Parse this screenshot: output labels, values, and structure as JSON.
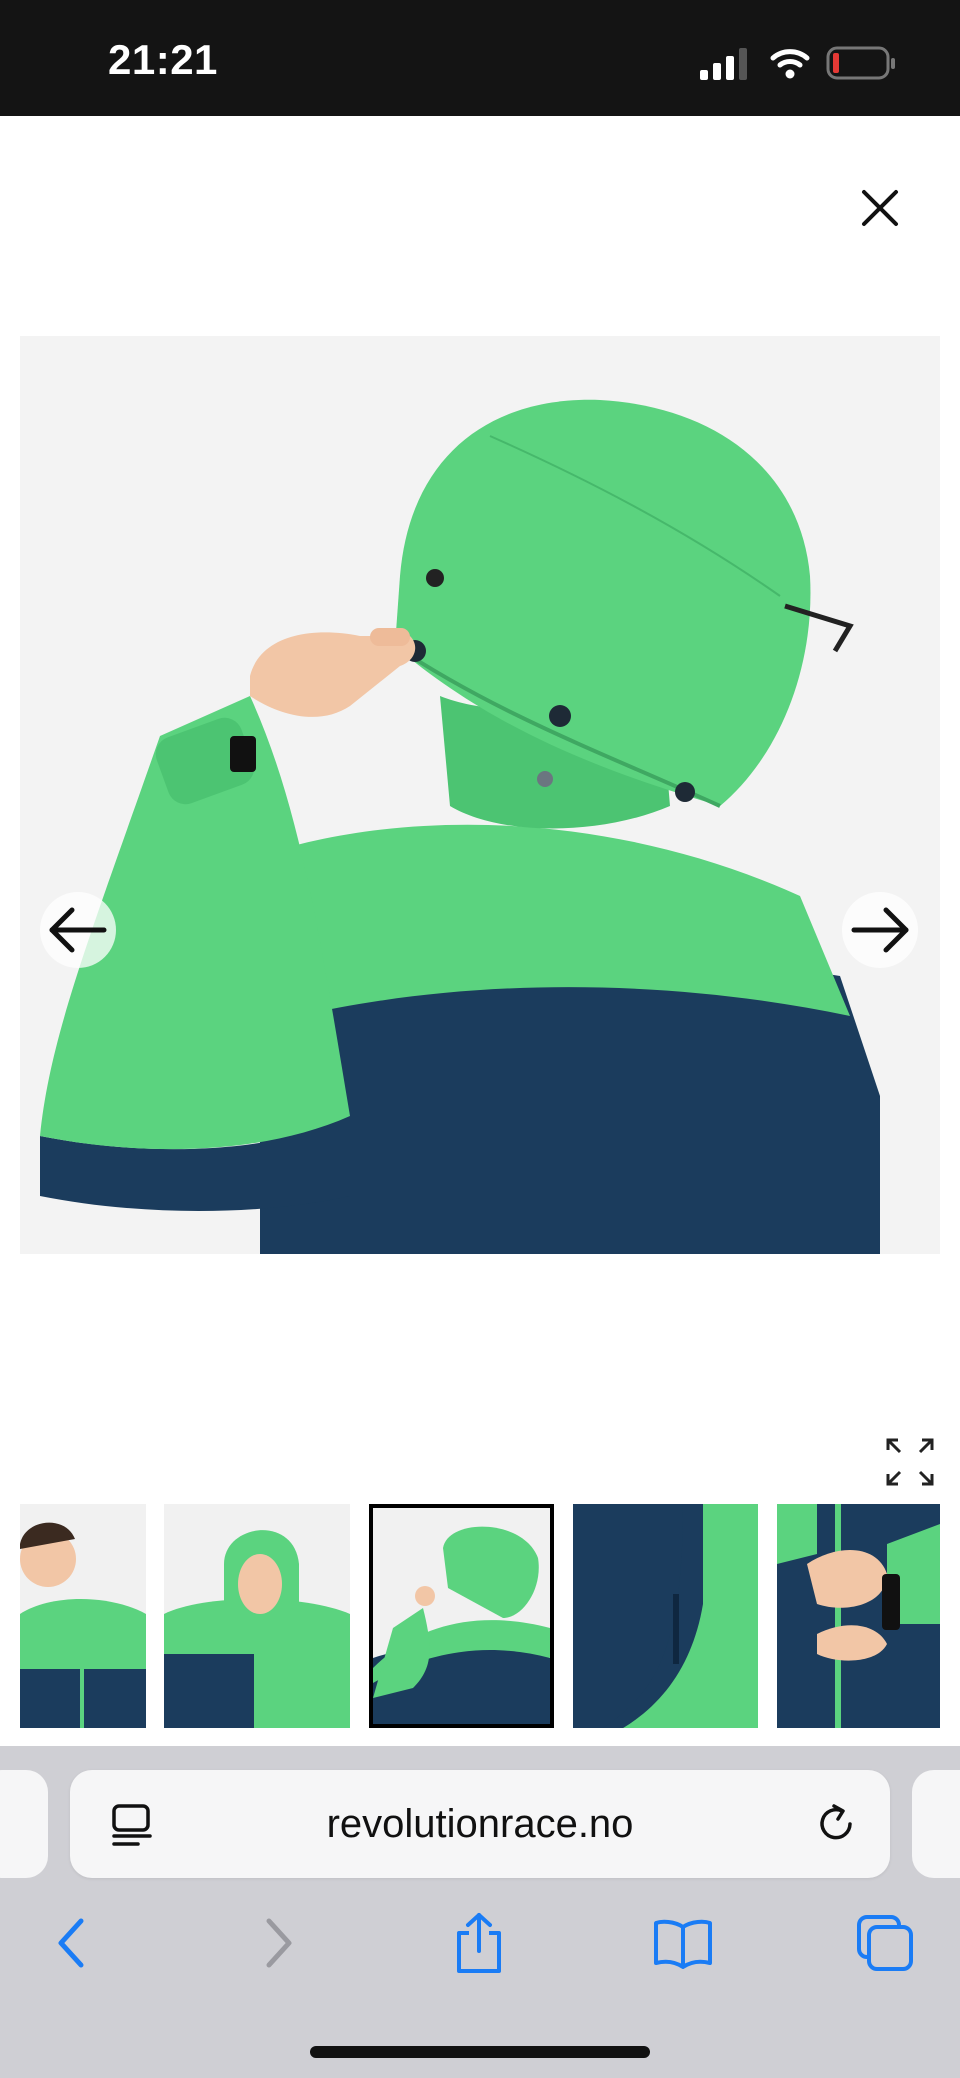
{
  "status_bar": {
    "time": "21:21",
    "icons": [
      "signal-icon",
      "wifi-icon",
      "battery-low-icon"
    ],
    "battery_color": "#e53935"
  },
  "viewer": {
    "close_icon": "close-icon",
    "prev_icon": "arrow-left-icon",
    "next_icon": "arrow-right-icon",
    "expand_icon": "expand-icon",
    "selected_thumbnail_index": 3,
    "thumbnail_count": 5,
    "colors": {
      "jacket_green": "#5bd37f",
      "jacket_navy": "#1b3c5d"
    }
  },
  "browser": {
    "url": "revolutionrace.no",
    "accent": "#1a7cf5",
    "toolbar": [
      "back-icon",
      "forward-icon",
      "share-icon",
      "bookmarks-icon",
      "tabs-icon"
    ]
  }
}
